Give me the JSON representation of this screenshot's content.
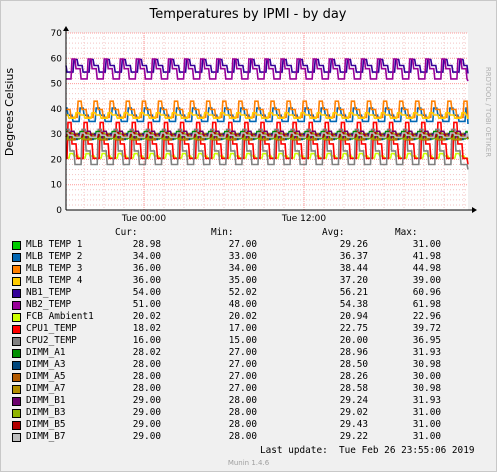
{
  "chart_data": {
    "type": "line",
    "title": "Temperatures by IPMI - by day",
    "ylabel": "Degrees Celsius",
    "watermark": "RRDTOOL / TOBI OETIKER",
    "ylim": [
      0,
      70
    ],
    "yticks": [
      0,
      10,
      20,
      30,
      40,
      50,
      60,
      70
    ],
    "xticks": [
      "Tue 00:00",
      "Tue 12:00"
    ],
    "grid": true,
    "legend_header": {
      "cur": "Cur:",
      "min": "Min:",
      "avg": "Avg:",
      "max": "Max:"
    },
    "series": [
      {
        "name": "MLB TEMP 1",
        "color": "#00cc00",
        "cur": "28.98",
        "min": "27.00",
        "avg": "29.26",
        "max": "31.00",
        "values": [
          29,
          29,
          29,
          29
        ]
      },
      {
        "name": "MLB TEMP 2",
        "color": "#0066b3",
        "cur": "34.00",
        "min": "33.00",
        "avg": "36.37",
        "max": "41.98",
        "values": [
          36,
          34,
          37,
          34
        ]
      },
      {
        "name": "MLB TEMP 3",
        "color": "#ff8000",
        "cur": "36.00",
        "min": "34.00",
        "avg": "38.44",
        "max": "44.98",
        "values": [
          38,
          35,
          44,
          36
        ]
      },
      {
        "name": "MLB TEMP 4",
        "color": "#ffcc00",
        "cur": "36.00",
        "min": "35.00",
        "avg": "37.20",
        "max": "39.00",
        "values": [
          37,
          36,
          39,
          36
        ]
      },
      {
        "name": "NB1_TEMP",
        "color": "#330099",
        "cur": "54.00",
        "min": "52.02",
        "avg": "56.21",
        "max": "60.96",
        "values": [
          56,
          53,
          60,
          54
        ]
      },
      {
        "name": "NB2_TEMP",
        "color": "#990099",
        "cur": "51.00",
        "min": "48.00",
        "avg": "54.38",
        "max": "61.98",
        "values": [
          54,
          49,
          61,
          51
        ]
      },
      {
        "name": "FCB Ambient1",
        "color": "#ccff00",
        "cur": "20.02",
        "min": "20.02",
        "avg": "20.94",
        "max": "22.96",
        "values": [
          21,
          20,
          22,
          20
        ]
      },
      {
        "name": "CPU1_TEMP",
        "color": "#ff0000",
        "cur": "18.02",
        "min": "17.00",
        "avg": "22.75",
        "max": "39.72",
        "values": [
          19,
          17,
          38,
          18
        ]
      },
      {
        "name": "CPU2_TEMP",
        "color": "#808080",
        "cur": "16.00",
        "min": "15.00",
        "avg": "20.00",
        "max": "36.95",
        "values": [
          17,
          15,
          36,
          16
        ]
      },
      {
        "name": "DIMM_A1",
        "color": "#008f00",
        "cur": "28.02",
        "min": "27.00",
        "avg": "28.96",
        "max": "31.93",
        "values": [
          29,
          27,
          31,
          28
        ]
      },
      {
        "name": "DIMM_A3",
        "color": "#00487d",
        "cur": "28.00",
        "min": "27.00",
        "avg": "28.50",
        "max": "30.98",
        "values": [
          28,
          27,
          30,
          28
        ]
      },
      {
        "name": "DIMM_A5",
        "color": "#b35a00",
        "cur": "28.00",
        "min": "27.00",
        "avg": "28.26",
        "max": "30.00",
        "values": [
          28,
          27,
          30,
          28
        ]
      },
      {
        "name": "DIMM_A7",
        "color": "#b38f00",
        "cur": "28.00",
        "min": "27.00",
        "avg": "28.58",
        "max": "30.98",
        "values": [
          28,
          27,
          30,
          28
        ]
      },
      {
        "name": "DIMM_B1",
        "color": "#6b006b",
        "cur": "29.00",
        "min": "28.00",
        "avg": "29.24",
        "max": "31.93",
        "values": [
          29,
          28,
          31,
          29
        ]
      },
      {
        "name": "DIMM_B3",
        "color": "#8fb300",
        "cur": "29.00",
        "min": "28.00",
        "avg": "29.02",
        "max": "31.00",
        "values": [
          29,
          28,
          31,
          29
        ]
      },
      {
        "name": "DIMM_B5",
        "color": "#b30000",
        "cur": "29.00",
        "min": "28.00",
        "avg": "29.43",
        "max": "31.00",
        "values": [
          29,
          28,
          31,
          29
        ]
      },
      {
        "name": "DIMM_B7",
        "color": "#bebebe",
        "cur": "29.00",
        "min": "28.00",
        "avg": "29.22",
        "max": "31.00",
        "values": [
          29,
          28,
          31,
          29
        ]
      }
    ]
  },
  "footer": {
    "last_update": "Last update:  Tue Feb 26 23:55:06 2019",
    "munin_version": "Munin 1.4.6"
  }
}
